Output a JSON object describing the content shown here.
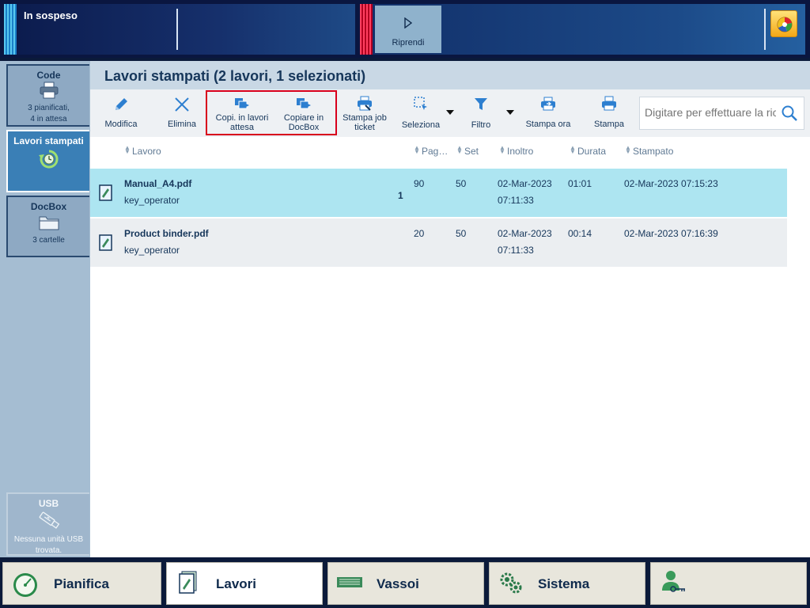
{
  "status": {
    "text": "In sospeso",
    "resume_label": "Riprendi"
  },
  "sidebar": {
    "code": {
      "title": "Code",
      "line1": "3 pianificati,",
      "line2": "4 in attesa"
    },
    "printed": {
      "title": "Lavori stampati"
    },
    "docbox": {
      "title": "DocBox",
      "sub": "3 cartelle"
    },
    "usb": {
      "title": "USB",
      "line1": "Nessuna unità USB",
      "line2": "trovata."
    }
  },
  "page": {
    "title": "Lavori stampati (2 lavori, 1 selezionati)"
  },
  "toolbar": {
    "edit": "Modifica",
    "delete": "Elimina",
    "copy_waiting_1": "Copi. in lavori",
    "copy_waiting_2": "attesa",
    "copy_docbox_1": "Copiare in",
    "copy_docbox_2": "DocBox",
    "print_ticket_1": "Stampa job",
    "print_ticket_2": "ticket",
    "select": "Seleziona",
    "filter": "Filtro",
    "print_now": "Stampa ora",
    "print": "Stampa",
    "search_placeholder": "Digitare per effettuare la ricerca"
  },
  "columns": {
    "job": "Lavoro",
    "pages": "Pag…",
    "sets": "Set",
    "submitted": "Inoltro",
    "duration": "Durata",
    "printed": "Stampato"
  },
  "jobs": [
    {
      "name": "Manual_A4.pdf",
      "owner": "key_operator",
      "count": "1",
      "pages": "90",
      "sets": "50",
      "submitted_date": "02-Mar-2023",
      "submitted_time": "07:11:33",
      "duration": "01:01",
      "printed": "02-Mar-2023 07:15:23"
    },
    {
      "name": "Product binder.pdf",
      "owner": "key_operator",
      "count": "",
      "pages": "20",
      "sets": "50",
      "submitted_date": "02-Mar-2023",
      "submitted_time": "07:11:33",
      "duration": "00:14",
      "printed": "02-Mar-2023 07:16:39"
    }
  ],
  "nav": {
    "schedule": "Pianifica",
    "jobs": "Lavori",
    "trays": "Vassoi",
    "system": "Sistema"
  }
}
